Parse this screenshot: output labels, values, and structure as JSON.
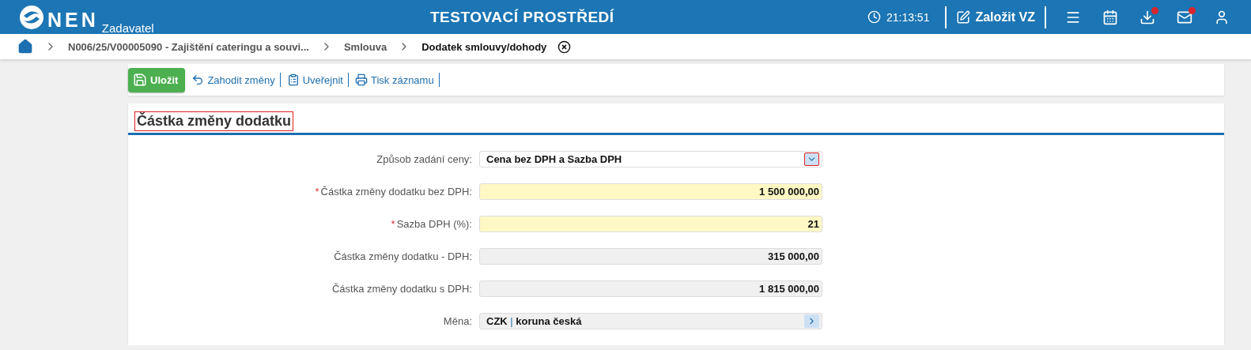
{
  "header": {
    "logo_text": "NEN",
    "logo_subtitle": "Zadavatel",
    "environment": "TESTOVACÍ PROSTŘEDÍ",
    "clock": "21:13:51",
    "create_button": "Založit VZ",
    "icons": [
      {
        "kind": "menu",
        "badge": false
      },
      {
        "kind": "calendar",
        "badge": false
      },
      {
        "kind": "download",
        "badge": true
      },
      {
        "kind": "mail",
        "badge": true
      },
      {
        "kind": "user",
        "badge": false
      }
    ]
  },
  "breadcrumb": [
    {
      "label": "N006/25/V00005090 - Zajištění cateringu a souvi...",
      "current": false
    },
    {
      "label": "Smlouva",
      "current": false
    },
    {
      "label": "Dodatek smlouvy/dohody",
      "current": true
    }
  ],
  "toolbar": [
    {
      "kind": "save",
      "label": "Uložit",
      "primary": true
    },
    {
      "kind": "discard",
      "label": "Zahodit změny",
      "primary": false
    },
    {
      "kind": "publish",
      "label": "Uveřejnit",
      "primary": false
    },
    {
      "kind": "print",
      "label": "Tisk záznamu",
      "primary": false
    }
  ],
  "section": {
    "title": "Částka změny dodatku",
    "highlighted": true
  },
  "fields": [
    {
      "kind": "select",
      "label": "Způsob zadání ceny:",
      "required": false,
      "value": "Cena bez DPH a Sazba DPH",
      "highlighted": true
    },
    {
      "kind": "input",
      "label": "Částka změny dodatku bez DPH:",
      "required": true,
      "value": "1 500 000,00"
    },
    {
      "kind": "input",
      "label": "Sazba DPH (%):",
      "required": true,
      "value": "21"
    },
    {
      "kind": "readonly",
      "label": "Částka změny dodatku - DPH:",
      "required": false,
      "value": "315 000,00"
    },
    {
      "kind": "readonly",
      "label": "Částka změny dodatku s DPH:",
      "required": false,
      "value": "1 815 000,00"
    },
    {
      "kind": "lookup",
      "label": "Měna:",
      "required": false,
      "code": "CZK",
      "separator": "|",
      "value": "koruna česká"
    }
  ],
  "required_mark": "*"
}
